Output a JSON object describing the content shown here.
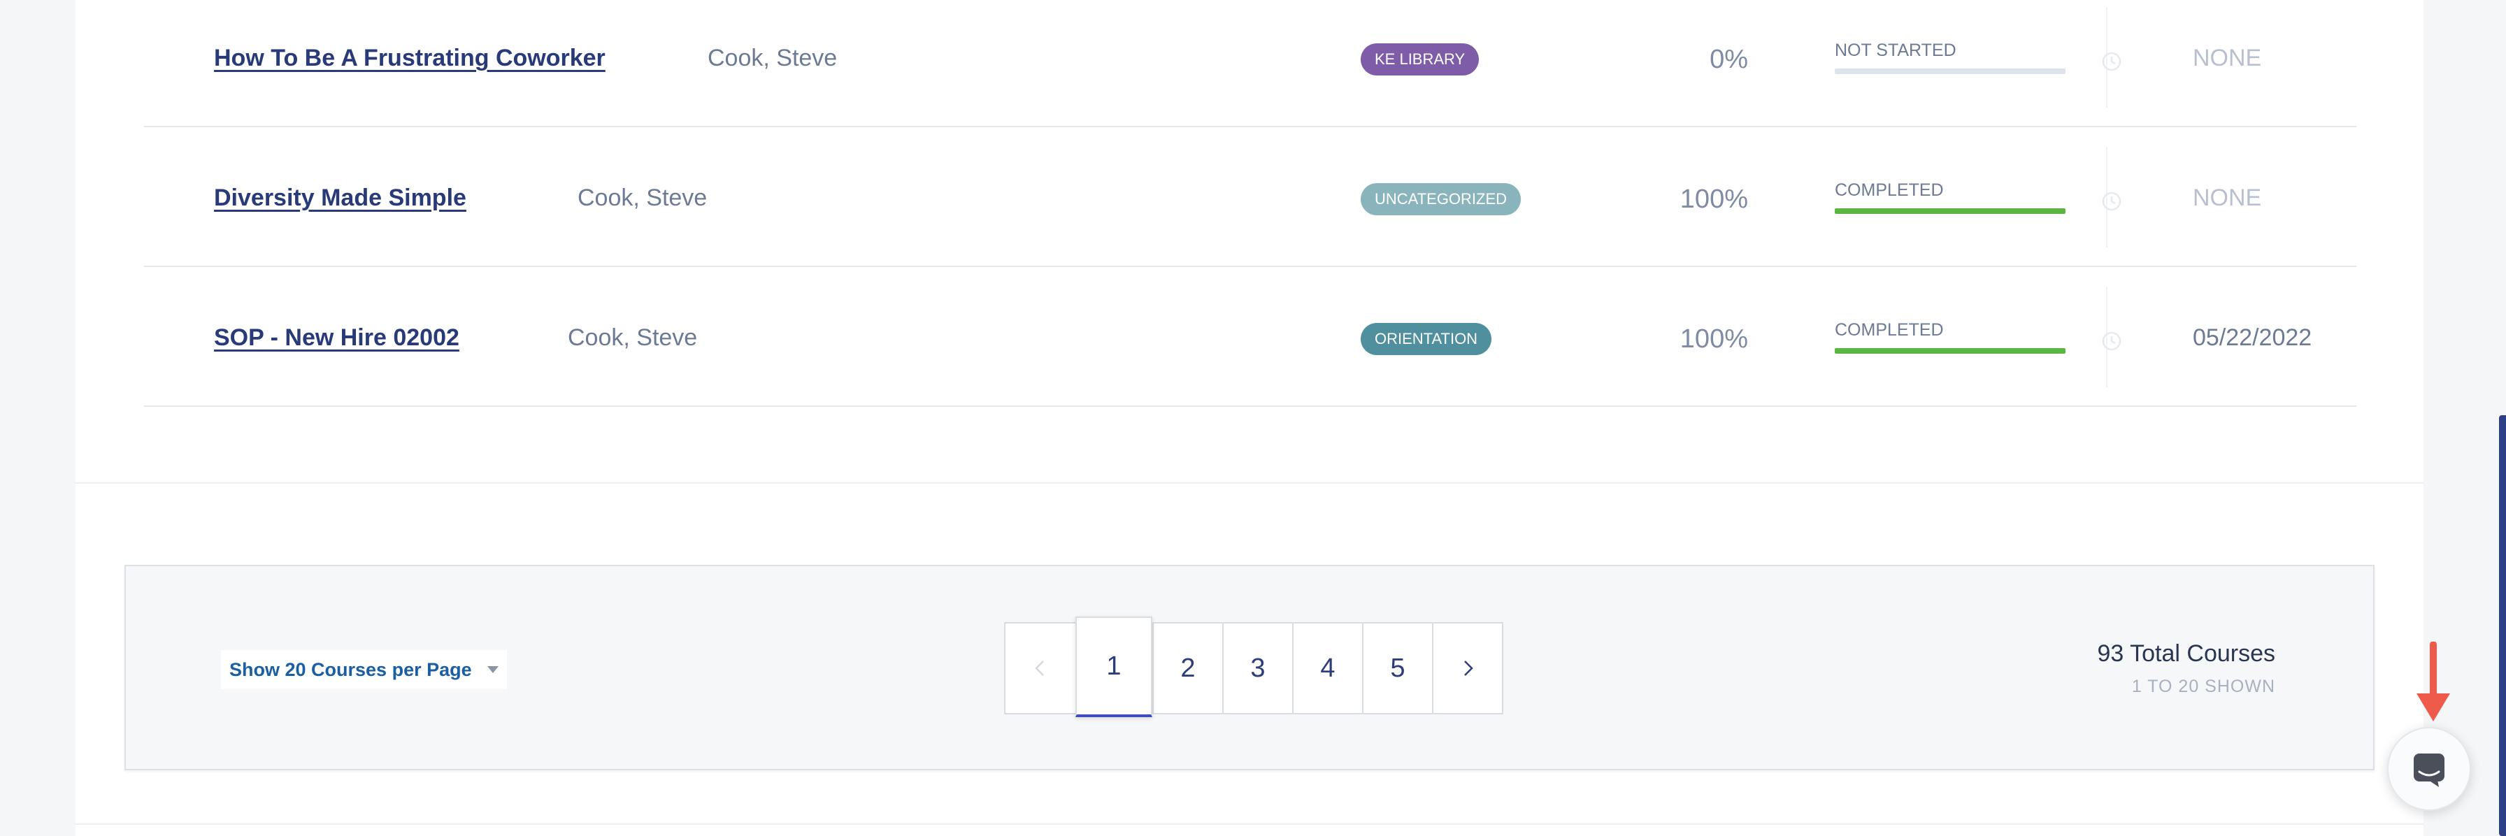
{
  "courses": [
    {
      "title": "How To Be A Frustrating Coworker",
      "author": "Cook, Steve",
      "category": "KE LIBRARY",
      "category_color": "#7e5ca8",
      "percent": "0%",
      "progress_fraction": 0,
      "status": "NOT STARTED",
      "due": "NONE"
    },
    {
      "title": "Diversity Made Simple",
      "author": "Cook, Steve",
      "category": "UNCATEGORIZED",
      "category_color": "#8ab4bc",
      "percent": "100%",
      "progress_fraction": 1,
      "status": "COMPLETED",
      "due": "NONE"
    },
    {
      "title": "SOP - New Hire 02002",
      "author": "Cook, Steve",
      "category": "ORIENTATION",
      "category_color": "#4f8f9e",
      "percent": "100%",
      "progress_fraction": 1,
      "status": "COMPLETED",
      "due": "05/22/2022"
    }
  ],
  "pagination": {
    "per_page_label": "Show 20 Courses per Page",
    "pages": [
      "1",
      "2",
      "3",
      "4",
      "5"
    ],
    "current_page": "1",
    "total_label": "93 Total Courses",
    "shown_label": "1 TO 20 SHOWN"
  },
  "colors": {
    "progress_complete": "#5cb543",
    "due_muted": "#b8c0cf",
    "due_set": "#6d7a93",
    "accent_arrow": "#ef5b4b"
  },
  "icons": {
    "clock": "clock-icon",
    "prev": "chevron-left-icon",
    "next": "chevron-right-icon",
    "chat": "chat-icon",
    "help_arrow": "arrow-down-icon"
  }
}
